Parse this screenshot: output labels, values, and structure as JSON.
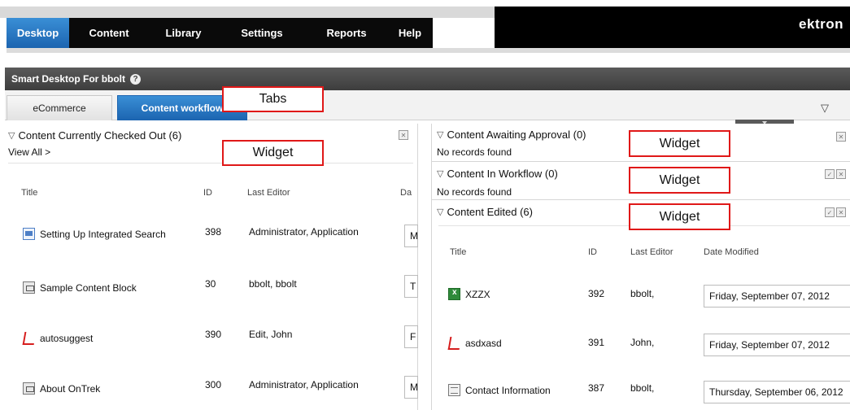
{
  "nav": {
    "items": [
      "Desktop",
      "Content",
      "Library",
      "Settings",
      "Reports",
      "Help"
    ],
    "logo": "ektron"
  },
  "header": {
    "title": "Smart Desktop For bbolt",
    "help_icon": "?"
  },
  "tabs": {
    "items": [
      "eCommerce",
      "Content workflow"
    ],
    "active": "Content workflow",
    "toggle": "▽"
  },
  "callouts": {
    "tabs": "Tabs",
    "widget": "Widget"
  },
  "left_widget": {
    "title": "Content Currently Checked Out (6)",
    "view_all": "View All >",
    "columns": [
      "Title",
      "ID",
      "Last Editor",
      "Da"
    ],
    "rows": [
      {
        "icon": "html",
        "title": "Setting Up Integrated Search",
        "id": "398",
        "editor": "Administrator, Application",
        "date": "M"
      },
      {
        "icon": "block",
        "title": "Sample Content Block",
        "id": "30",
        "editor": "bbolt, bbolt",
        "date": "T"
      },
      {
        "icon": "pdf",
        "title": "autosuggest",
        "id": "390",
        "editor": "Edit, John",
        "date": "F"
      },
      {
        "icon": "block",
        "title": "About OnTrek",
        "id": "300",
        "editor": "Administrator, Application",
        "date": "M"
      }
    ]
  },
  "right_widgets": {
    "awaiting": {
      "title": "Content Awaiting Approval (0)",
      "status": "No records found"
    },
    "workflow": {
      "title": "Content In Workflow (0)",
      "status": "No records found"
    },
    "edited": {
      "title": "Content Edited (6)",
      "columns": [
        "Title",
        "ID",
        "Last Editor",
        "Date Modified"
      ],
      "rows": [
        {
          "icon": "xls",
          "title": "XZZX",
          "id": "392",
          "editor": "bbolt,",
          "date": "Friday, September 07, 2012"
        },
        {
          "icon": "pdf",
          "title": "asdxasd",
          "id": "391",
          "editor": "John,",
          "date": "Friday, September 07, 2012"
        },
        {
          "icon": "form",
          "title": "Contact Information",
          "id": "387",
          "editor": "bbolt,",
          "date": "Thursday, September 06, 2012"
        }
      ]
    }
  }
}
